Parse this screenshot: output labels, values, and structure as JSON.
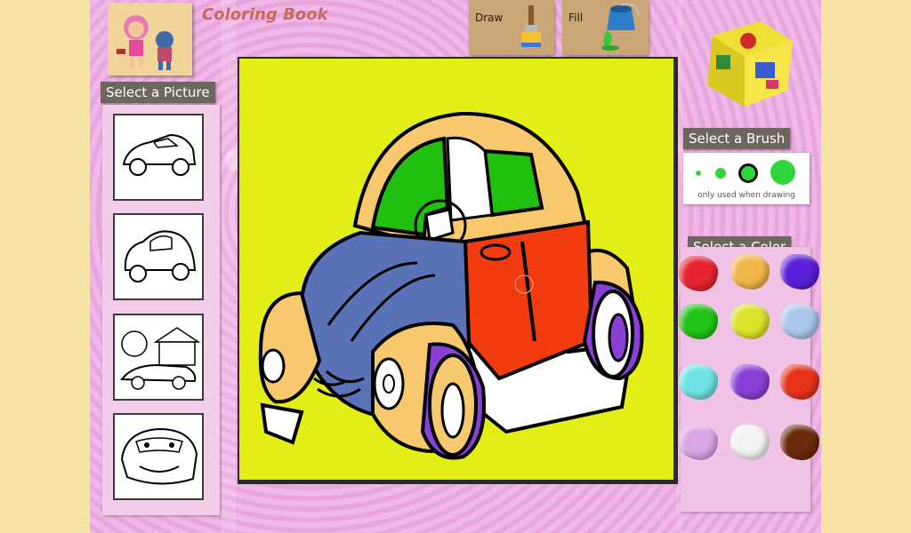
{
  "app": {
    "title": "Coloring Book",
    "tools": {
      "draw_label": "Draw",
      "fill_label": "Fill"
    }
  },
  "pictures": {
    "heading": "Select a Picture",
    "items": [
      {
        "name": "sports-car"
      },
      {
        "name": "beetle-car"
      },
      {
        "name": "house-car"
      },
      {
        "name": "cartoon-car"
      }
    ]
  },
  "brush": {
    "heading": "Select a Brush",
    "note": "only used when drawing",
    "sizes": [
      "small",
      "medium",
      "large-ring",
      "extra-large"
    ],
    "color": "#2fd53a"
  },
  "colors": {
    "heading": "Select a Color",
    "palette": [
      "#e8232f",
      "#f2b54a",
      "#5a1fd8",
      "#22c417",
      "#dde22a",
      "#a9c6ea",
      "#6fe2e4",
      "#8a3fd6",
      "#e8331a",
      "#d9a6e6",
      "#f2f2f2",
      "#6a2a0c"
    ]
  },
  "canvas": {
    "background": "#e3ee17",
    "car_colors": {
      "roof": "#f7c86e",
      "window": "#1fc010",
      "hood": "#5a72b8",
      "door": "#f23c10",
      "tire": "#8a3fd6",
      "body": "#ffffff"
    }
  }
}
